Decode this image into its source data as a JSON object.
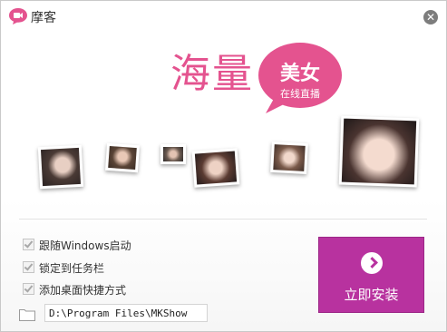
{
  "titlebar": {
    "app_name": "摩客",
    "logo_icon": "camera-chat-bubble-icon",
    "close_icon": "close-icon",
    "brand_color": "#e4538f"
  },
  "banner": {
    "headline": "海量",
    "bubble_main": "美女",
    "bubble_sub": "在线直播",
    "bubble_color": "#e4538f"
  },
  "options": [
    {
      "label": "跟随Windows启动",
      "checked": true
    },
    {
      "label": "锁定到任务栏",
      "checked": true
    },
    {
      "label": "添加桌面快捷方式",
      "checked": true
    }
  ],
  "install_path": {
    "value": "D:\\Program Files\\MKShow",
    "icon": "folder-icon"
  },
  "install_button": {
    "label": "立即安装",
    "icon": "arrow-right-circle-icon",
    "color": "#b8329f"
  }
}
